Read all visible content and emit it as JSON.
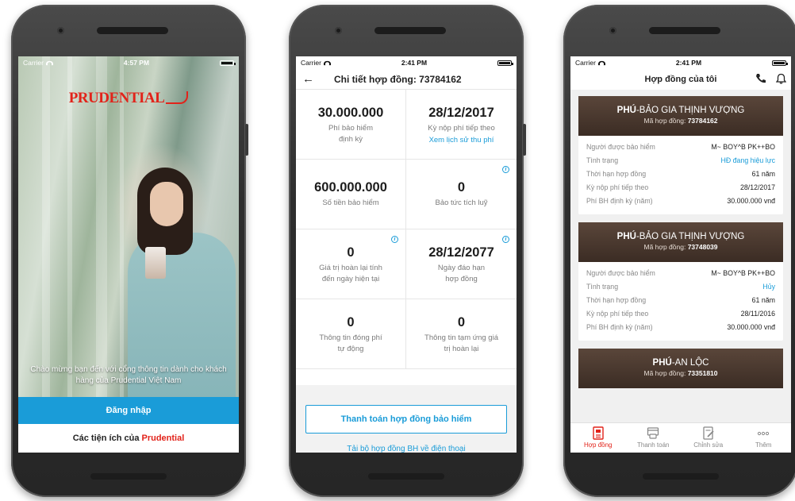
{
  "phone1": {
    "status": {
      "carrier": "Carrier",
      "time": "4:57 PM"
    },
    "logo_text": "PRUDENTIAL",
    "welcome_text": "Chào mừng bạn đến với cổng thông tin dành cho khách hàng của Prudential Việt Nam",
    "login_label": "Đăng nhập",
    "utilities_prefix": "Các tiện ích của ",
    "utilities_brand": "Prudential",
    "colors": {
      "brand_red": "#e2231a",
      "accent_blue": "#1a9cd8"
    }
  },
  "phone2": {
    "status": {
      "carrier": "Carrier",
      "time": "2:41 PM"
    },
    "title": "Chi tiết hợp đồng: 73784162",
    "cells": [
      {
        "value": "30.000.000",
        "label": "Phí bảo hiểm định kỳ",
        "link": ""
      },
      {
        "value": "28/12/2017",
        "label": "Kỳ nộp phí tiếp theo",
        "link": "Xem lịch sử thu phí"
      },
      {
        "value": "600.000.000",
        "label": "Số tiền bảo hiểm",
        "link": ""
      },
      {
        "value": "0",
        "label": "Bảo tức tích luỹ",
        "link": ""
      },
      {
        "value": "0",
        "label": "Giá trị hoàn lại tính đến ngày hiện tại",
        "link": ""
      },
      {
        "value": "28/12/2077",
        "label": "Ngày đáo hạn hợp đồng",
        "link": ""
      },
      {
        "value": "0",
        "label": "Thông tin đóng phí tự động",
        "link": ""
      },
      {
        "value": "0",
        "label": "Thông tin tạm ứng giá trị hoàn lại",
        "link": ""
      }
    ],
    "pay_button": "Thanh toán hợp đồng bảo hiểm",
    "download_link": "Tải bộ hợp đồng BH về điện thoại"
  },
  "phone3": {
    "status": {
      "carrier": "Carrier",
      "time": "2:41 PM"
    },
    "title": "Hợp đồng của tôi",
    "cards": [
      {
        "name_bold": "PHÚ",
        "name_rest": "-BẢO GIA THỊNH VƯỢNG",
        "contract_label": "Mã hợp đồng: ",
        "contract_no": "73784162",
        "rows": [
          {
            "k": "Người được bảo hiểm",
            "v": "M~ BOY^B PK++BO"
          },
          {
            "k": "Tình trạng",
            "v": "HĐ đang hiệu lực"
          },
          {
            "k": "Thời hạn hợp đồng",
            "v": "61 năm"
          },
          {
            "k": "Kỳ nộp phí tiếp theo",
            "v": "28/12/2017"
          },
          {
            "k": "Phí BH định kỳ (năm)",
            "v": "30.000.000 vnđ"
          }
        ]
      },
      {
        "name_bold": "PHÚ",
        "name_rest": "-BẢO GIA THỊNH VƯỢNG",
        "contract_label": "Mã hợp đồng: ",
        "contract_no": "73748039",
        "rows": [
          {
            "k": "Người được bảo hiểm",
            "v": "M~ BOY^B PK++BO"
          },
          {
            "k": "Tình trạng",
            "v": "Hủy"
          },
          {
            "k": "Thời hạn hợp đồng",
            "v": "61 năm"
          },
          {
            "k": "Kỳ nộp phí tiếp theo",
            "v": "28/11/2016"
          },
          {
            "k": "Phí BH định kỳ (năm)",
            "v": "30.000.000 vnđ"
          }
        ]
      },
      {
        "name_bold": "PHÚ",
        "name_rest": "-AN LỘC",
        "contract_label": "Mã hợp đồng: ",
        "contract_no": "73351810",
        "rows": []
      }
    ],
    "tabs": [
      {
        "label": "Hợp đồng",
        "icon": "document-icon"
      },
      {
        "label": "Thanh toán",
        "icon": "payment-icon"
      },
      {
        "label": "Chỉnh sửa",
        "icon": "edit-document-icon"
      },
      {
        "label": "Thêm",
        "icon": "more-icon"
      }
    ]
  }
}
